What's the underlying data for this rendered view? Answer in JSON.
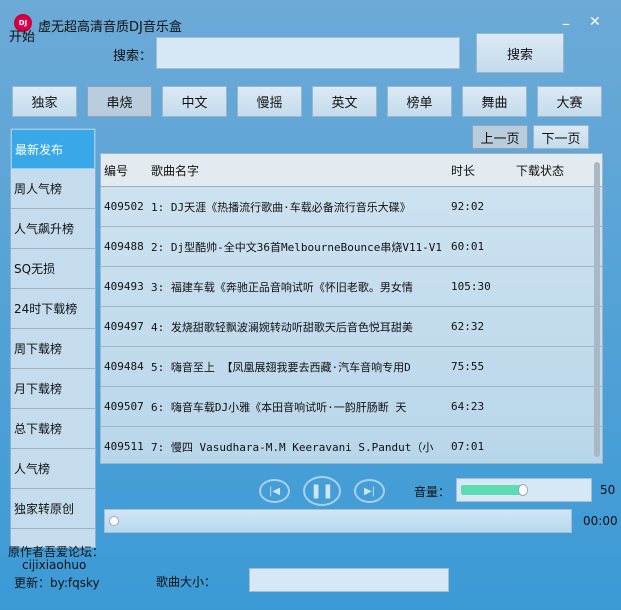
{
  "window": {
    "title": "虚无超高清音质DJ音乐盒",
    "logo_text": "DJ",
    "start_label": "开始",
    "minimize": "–",
    "close": "✕"
  },
  "search": {
    "label": "搜索：",
    "value": "",
    "placeholder": "",
    "button": "搜索"
  },
  "categories": [
    {
      "label": "独家"
    },
    {
      "label": "串烧",
      "active": true
    },
    {
      "label": "中文"
    },
    {
      "label": "慢摇"
    },
    {
      "label": "英文"
    },
    {
      "label": "榜单"
    },
    {
      "label": "舞曲"
    },
    {
      "label": "大赛"
    }
  ],
  "pager": {
    "prev": "上一页",
    "next": "下一页"
  },
  "sidebar": {
    "items": [
      {
        "label": "最新发布",
        "active": true
      },
      {
        "label": "周人气榜"
      },
      {
        "label": "人气飙升榜"
      },
      {
        "label": "SQ无损"
      },
      {
        "label": "24时下载榜"
      },
      {
        "label": "周下载榜"
      },
      {
        "label": "月下载榜"
      },
      {
        "label": "总下载榜"
      },
      {
        "label": "人气榜"
      },
      {
        "label": "独家转原创"
      }
    ]
  },
  "table": {
    "columns": [
      "编号",
      "歌曲名字",
      "时长",
      "下载状态"
    ],
    "rows": [
      {
        "id": "409502",
        "name": "1: DJ天涯《热播流行歌曲·车载必备流行音乐大碟》",
        "duration": "92:02",
        "status": ""
      },
      {
        "id": "409488",
        "name": "2: Dj型酷帅-全中文36首MelbourneBounce串烧V11-V1",
        "duration": "60:01",
        "status": ""
      },
      {
        "id": "409493",
        "name": "3: 福建车载《奔驰正品音响试听《怀旧老歌。男女情",
        "duration": "105:30",
        "status": ""
      },
      {
        "id": "409497",
        "name": "4: 发烧甜歌轻飘波澜婉转动听甜歌天后音色悦耳甜美",
        "duration": "62:32",
        "status": ""
      },
      {
        "id": "409484",
        "name": "5: 嗨音至上  【凤凰展翅我要去西藏·汽车音响专用D",
        "duration": "75:55",
        "status": ""
      },
      {
        "id": "409507",
        "name": "6: 嗨音车载DJ小雅《本田音响试听·一韵肝肠断 天",
        "duration": "64:23",
        "status": ""
      },
      {
        "id": "409511",
        "name": "7: 慢四  Vasudhara-M.M Keeravani S.Pandut（小",
        "duration": "07:01",
        "status": ""
      }
    ]
  },
  "player": {
    "volume_label": "音量：",
    "volume": 50,
    "volume_text": "50",
    "progress": 0,
    "time": "00:00",
    "volume_color": "#5ddcb4"
  },
  "footer": {
    "author_line1": "原作者吾爱论坛：",
    "author_line2": "cijixiaohuo",
    "update": "更新：by:fqsky",
    "size_label": "歌曲大小：",
    "size_value": ""
  }
}
